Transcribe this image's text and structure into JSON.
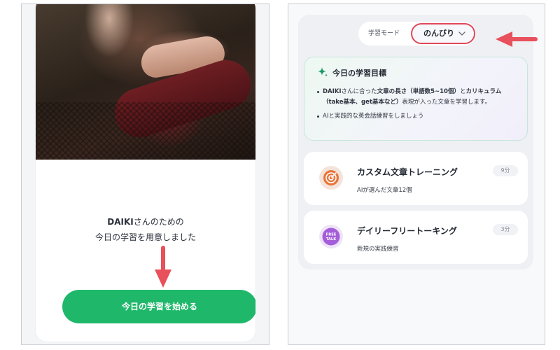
{
  "left": {
    "greeting_name": "DAIKI",
    "greeting_line1_rest": "さんのための",
    "greeting_line2": "今日の学習を用意しました",
    "start_button_label": "今日の学習を始める"
  },
  "right": {
    "mode_label": "学習モード",
    "mode_value": "のんびり",
    "goal": {
      "heading": "今日の学習目標",
      "items": [
        {
          "parts": [
            {
              "text": "DAIKI",
              "bold": true
            },
            {
              "text": "さんに合った",
              "bold": false
            },
            {
              "text": "文章の長さ（単語数5~10個）",
              "bold": true
            },
            {
              "text": "と",
              "bold": false
            },
            {
              "text": "カリキュラム（take基本、get基本など）",
              "bold": true
            },
            {
              "text": "表現が入った文章を学習します。",
              "bold": false
            }
          ]
        },
        {
          "parts": [
            {
              "text": "AIと実践的な英会話練習をしましょう",
              "bold": false
            }
          ]
        }
      ]
    },
    "lessons": [
      {
        "title": "カスタム文章トレーニング",
        "subtitle": "AIが選んだ文章12個",
        "duration": "9分",
        "icon": "target-icon"
      },
      {
        "title": "デイリーフリートーキング",
        "subtitle": "新規の実践練習",
        "duration": "3分",
        "icon": "free-talk-icon",
        "icon_text_top": "FREE",
        "icon_text_bottom": "TALK"
      }
    ]
  },
  "colors": {
    "primary_green": "#1fb86a",
    "highlight_red": "#e0485a",
    "accent_teal": "#1a9a6c",
    "target_orange": "#e8743b",
    "free_talk_purple": "#a55ed9"
  }
}
